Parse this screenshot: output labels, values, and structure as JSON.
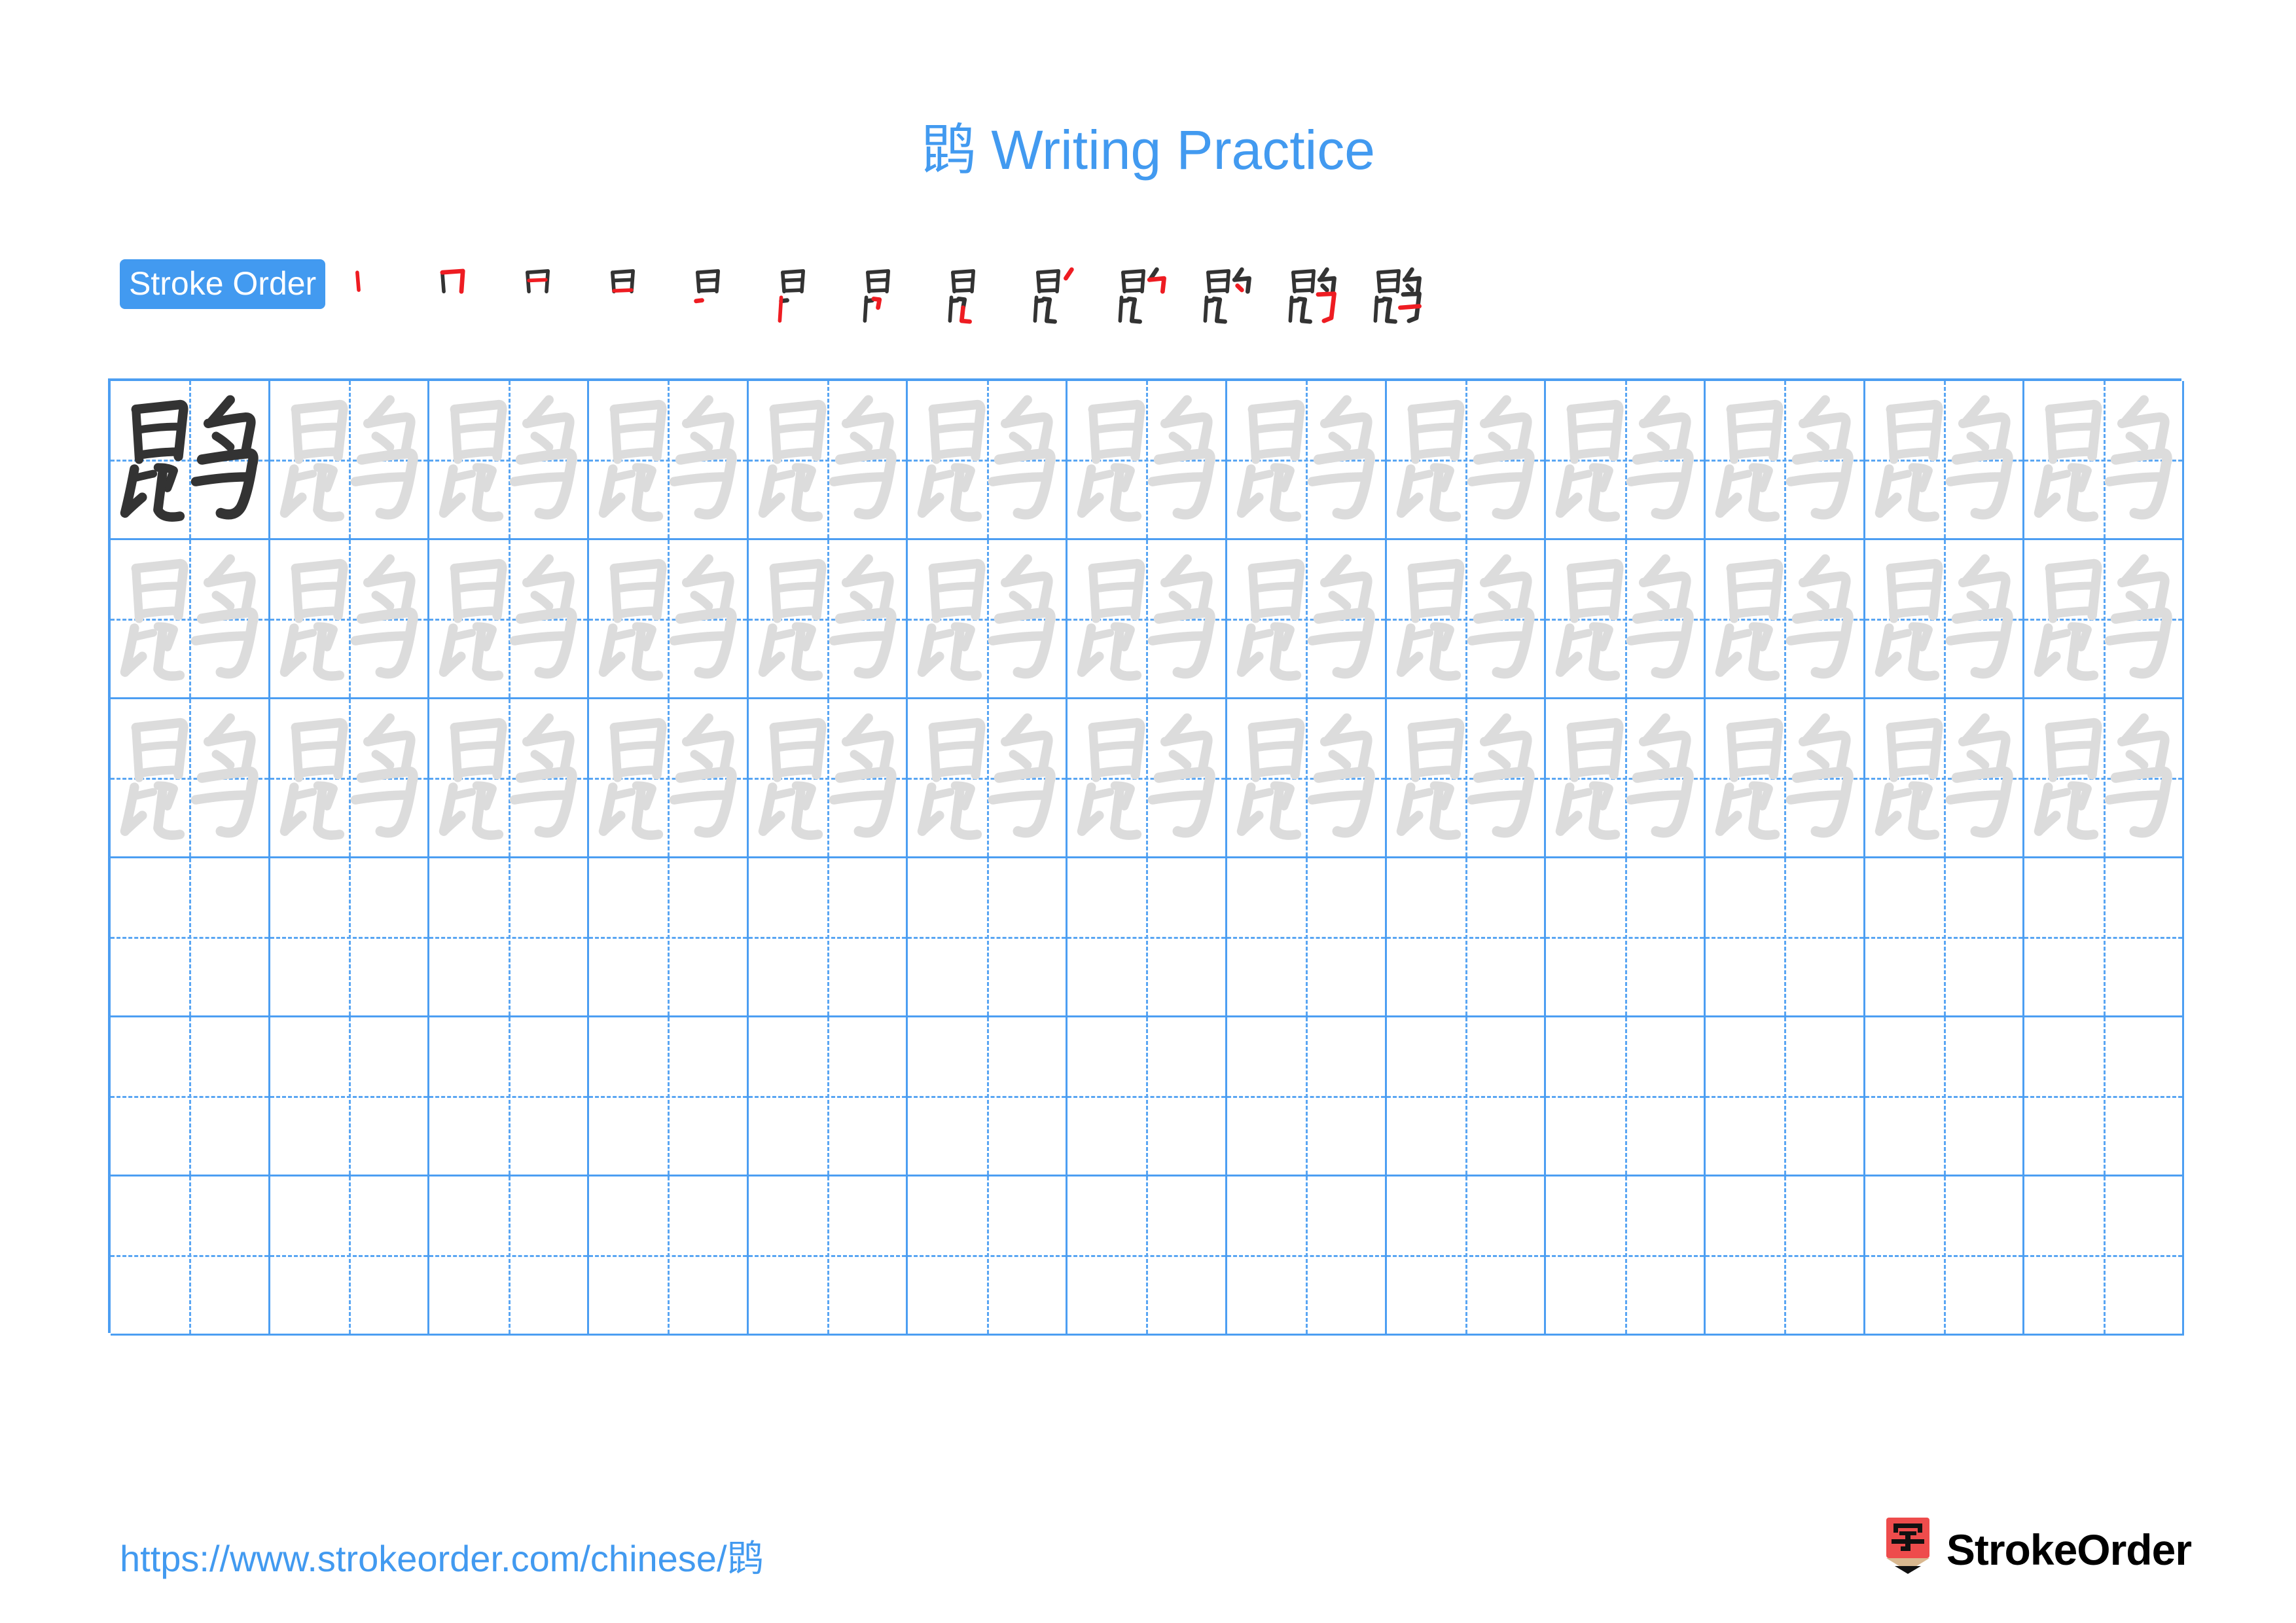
{
  "document": {
    "character": "鹍",
    "title": "鹍 Writing Practice",
    "title_character": "鹍",
    "title_text": " Writing Practice",
    "accent_color": "#429af0",
    "grid_line_color": "#4c9ef2",
    "guide_line_color": "#5aa6f3",
    "traced_glyph_color": "#dcdcdc",
    "solid_glyph_color": "#333333",
    "stroke_new_color": "#ee1c22",
    "stroke_old_color": "#333333"
  },
  "stroke_order": {
    "label": "Stroke Order",
    "total_strokes": 13,
    "steps": [
      {
        "index": 1,
        "new_stroke": "丨"
      },
      {
        "index": 2,
        "new_stroke": "𠃌"
      },
      {
        "index": 3,
        "new_stroke": "一"
      },
      {
        "index": 4,
        "new_stroke": "一"
      },
      {
        "index": 5,
        "new_stroke": "丶"
      },
      {
        "index": 6,
        "new_stroke": "丨"
      },
      {
        "index": 7,
        "new_stroke": "𠃍"
      },
      {
        "index": 8,
        "new_stroke": "乚"
      },
      {
        "index": 9,
        "new_stroke": "丿"
      },
      {
        "index": 10,
        "new_stroke": "𠃌"
      },
      {
        "index": 11,
        "new_stroke": "丶"
      },
      {
        "index": 12,
        "new_stroke": "乙"
      },
      {
        "index": 13,
        "new_stroke": "一"
      }
    ]
  },
  "practice_grid": {
    "columns": 13,
    "rows": 6,
    "rows_data": [
      {
        "row": 1,
        "cells": [
          "solid",
          "trace",
          "trace",
          "trace",
          "trace",
          "trace",
          "trace",
          "trace",
          "trace",
          "trace",
          "trace",
          "trace",
          "trace"
        ]
      },
      {
        "row": 2,
        "cells": [
          "trace",
          "trace",
          "trace",
          "trace",
          "trace",
          "trace",
          "trace",
          "trace",
          "trace",
          "trace",
          "trace",
          "trace",
          "trace"
        ]
      },
      {
        "row": 3,
        "cells": [
          "trace",
          "trace",
          "trace",
          "trace",
          "trace",
          "trace",
          "trace",
          "trace",
          "trace",
          "trace",
          "trace",
          "trace",
          "trace"
        ]
      },
      {
        "row": 4,
        "cells": [
          "empty",
          "empty",
          "empty",
          "empty",
          "empty",
          "empty",
          "empty",
          "empty",
          "empty",
          "empty",
          "empty",
          "empty",
          "empty"
        ]
      },
      {
        "row": 5,
        "cells": [
          "empty",
          "empty",
          "empty",
          "empty",
          "empty",
          "empty",
          "empty",
          "empty",
          "empty",
          "empty",
          "empty",
          "empty",
          "empty"
        ]
      },
      {
        "row": 6,
        "cells": [
          "empty",
          "empty",
          "empty",
          "empty",
          "empty",
          "empty",
          "empty",
          "empty",
          "empty",
          "empty",
          "empty",
          "empty",
          "empty"
        ]
      }
    ]
  },
  "footer": {
    "url_prefix": "https://www.strokeorder.com/chinese/",
    "url_character": "鹍",
    "brand_name": "StrokeOrder",
    "brand_mark_character": "字",
    "brand_mark_body_color": "#ee4c4c",
    "brand_mark_wood_color": "#d9b88f",
    "brand_mark_tip_color": "#111111"
  }
}
